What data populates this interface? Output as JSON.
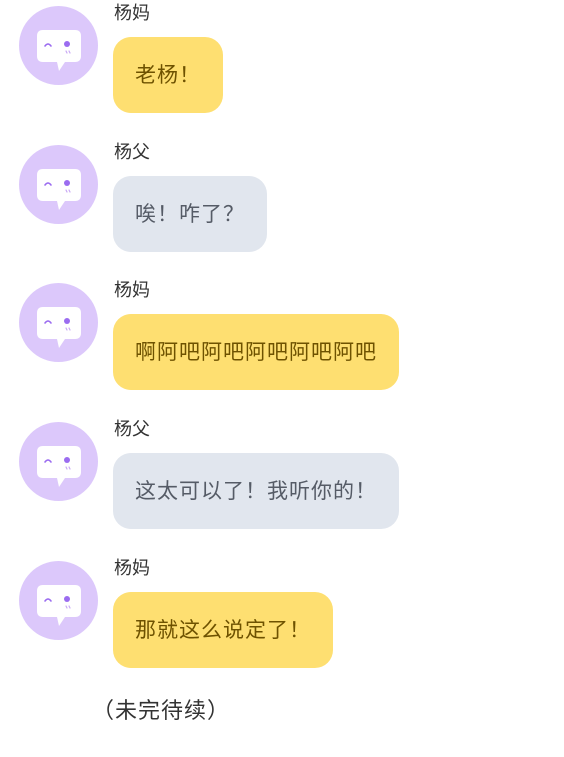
{
  "messages": [
    {
      "sender": "杨妈",
      "role": "mom",
      "text": "老杨！"
    },
    {
      "sender": "杨父",
      "role": "dad",
      "text": "唉！咋了？"
    },
    {
      "sender": "杨妈",
      "role": "mom",
      "text": "啊阿吧阿吧阿吧阿吧阿吧"
    },
    {
      "sender": "杨父",
      "role": "dad",
      "text": "这太可以了！我听你的！"
    },
    {
      "sender": "杨妈",
      "role": "mom",
      "text": "那就这么说定了！"
    }
  ],
  "footer": {
    "text": "（未完待续）"
  },
  "avatar_icon": "chat-bubble-face-icon",
  "colors": {
    "avatar_bg": "#dcc8fb",
    "mom_bubble": "#fedf71",
    "dad_bubble": "#e1e6ee",
    "accent_purple": "#9b6cf0"
  }
}
